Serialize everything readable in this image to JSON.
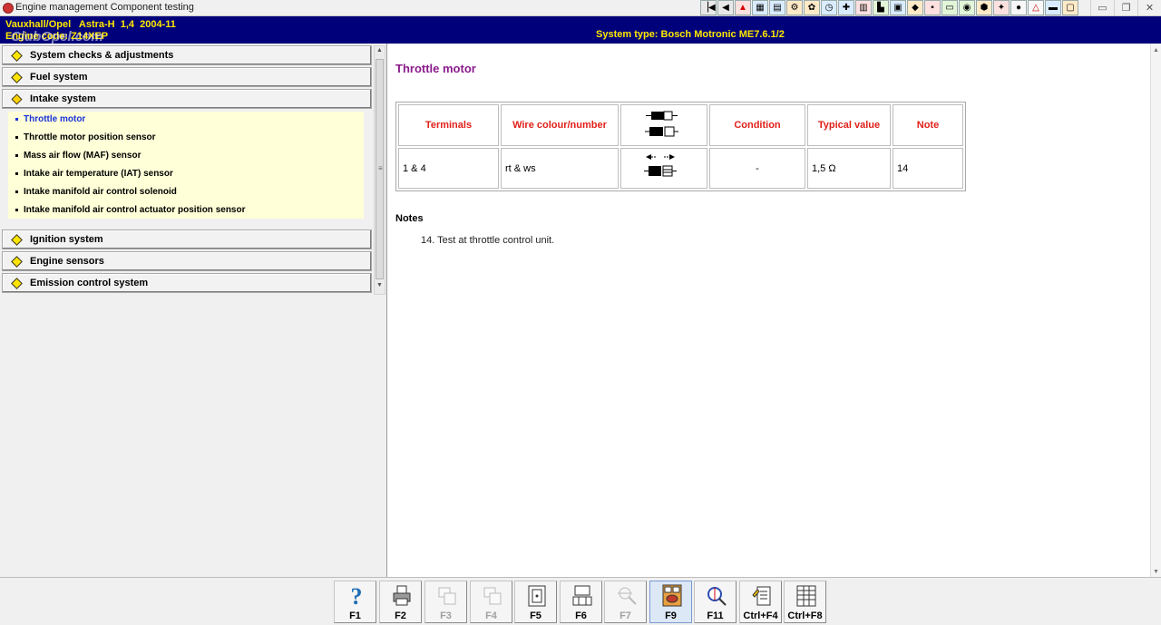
{
  "window": {
    "title": "Engine management Component testing"
  },
  "header": {
    "vehicle": "Vauxhall/Opel   Astra-H  1,4  2004-11",
    "engine": "Engine code: Z14XEP",
    "watermark": "ClubOpel.com",
    "system_type": "System type: Bosch Motronic ME7.6.1/2"
  },
  "sidebar": {
    "sections": [
      {
        "label": "System checks & adjustments"
      },
      {
        "label": "Fuel system"
      },
      {
        "label": "Intake system"
      },
      {
        "label": "Ignition system"
      },
      {
        "label": "Engine sensors"
      },
      {
        "label": "Emission control system"
      }
    ],
    "intake_items": [
      {
        "label": "Throttle motor",
        "active": true
      },
      {
        "label": "Throttle motor position sensor"
      },
      {
        "label": "Mass air flow (MAF) sensor"
      },
      {
        "label": "Intake air temperature (IAT) sensor"
      },
      {
        "label": "Intake manifold air control solenoid"
      },
      {
        "label": "Intake manifold air control actuator position sensor"
      }
    ]
  },
  "main": {
    "heading": "Throttle motor",
    "table": {
      "headers": [
        "Terminals",
        "Wire colour/number",
        "",
        "Condition",
        "Typical value",
        "Note"
      ],
      "rows": [
        [
          "1 & 4",
          "rt & ws",
          "",
          "-",
          "1,5 Ω",
          "14"
        ]
      ]
    },
    "notes_heading": "Notes",
    "notes": [
      "14. Test at throttle control unit."
    ]
  },
  "fkeys": [
    {
      "label": "F1",
      "icon": "help-icon",
      "enabled": true
    },
    {
      "label": "F2",
      "icon": "print-icon",
      "enabled": true
    },
    {
      "label": "F3",
      "icon": "diagram-icon",
      "enabled": false
    },
    {
      "label": "F4",
      "icon": "diagram-icon",
      "enabled": false
    },
    {
      "label": "F5",
      "icon": "connector-icon",
      "enabled": true
    },
    {
      "label": "F6",
      "icon": "connector-pins-icon",
      "enabled": true
    },
    {
      "label": "F7",
      "icon": "probe-icon",
      "enabled": false
    },
    {
      "label": "F9",
      "icon": "component-icon",
      "enabled": true,
      "pressed": true
    },
    {
      "label": "F11",
      "icon": "meter-icon",
      "enabled": true
    },
    {
      "label": "Ctrl+F4",
      "icon": "notes-icon",
      "enabled": true
    },
    {
      "label": "Ctrl+F8",
      "icon": "table-icon",
      "enabled": true
    }
  ],
  "toolbar_icons": [
    "first-icon",
    "prev-icon",
    "warning-icon",
    "module-icon",
    "chart-icon",
    "engine-icon",
    "gear-icon",
    "clock-icon",
    "tools-icon",
    "lift-icon",
    "car-icon",
    "battery-icon",
    "oil-icon",
    "connector-icon",
    "wiring-icon",
    "sensor-icon",
    "filter-icon",
    "spark-icon",
    "tire-icon",
    "info-icon",
    "book-icon"
  ],
  "colors": {
    "header_bg": "#00007a",
    "header_text": "#ffe800",
    "heading": "#8b1a8b",
    "table_header": "#e0201a",
    "active_item": "#1a33d8",
    "submenu_bg": "#ffffd8"
  }
}
